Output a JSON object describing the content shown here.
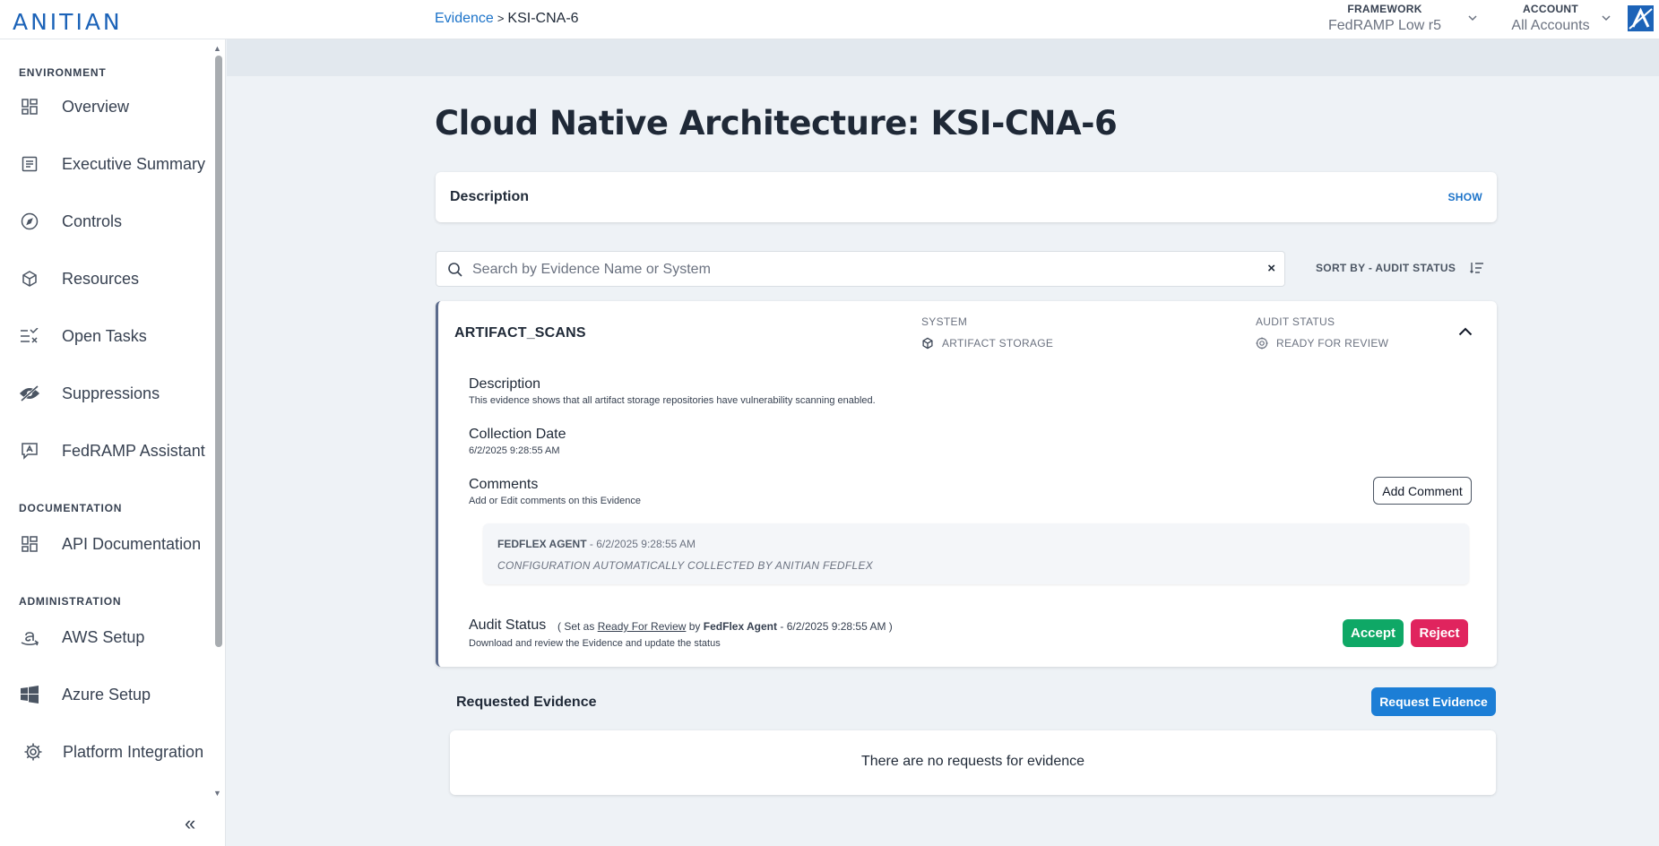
{
  "app": {
    "logo": "ANITIAN"
  },
  "header": {
    "framework_label": "FRAMEWORK",
    "framework_value": "FedRAMP Low r5",
    "account_label": "ACCOUNT",
    "account_value": "All Accounts"
  },
  "sidebar": {
    "sections": {
      "environment": "ENVIRONMENT",
      "documentation": "DOCUMENTATION",
      "administration": "ADMINISTRATION"
    },
    "items": [
      {
        "label": "Overview",
        "icon": "dashboard-icon"
      },
      {
        "label": "Executive Summary",
        "icon": "document-icon"
      },
      {
        "label": "Controls",
        "icon": "compass-icon"
      },
      {
        "label": "Resources",
        "icon": "cube-icon"
      },
      {
        "label": "Open Tasks",
        "icon": "tasks-icon"
      },
      {
        "label": "Suppressions",
        "icon": "eye-off-icon"
      },
      {
        "label": "FedRAMP Assistant",
        "icon": "assistant-icon"
      },
      {
        "label": "API Documentation",
        "icon": "dashboard-icon"
      },
      {
        "label": "AWS Setup",
        "icon": "amazon-icon"
      },
      {
        "label": "Azure Setup",
        "icon": "windows-icon"
      },
      {
        "label": "Platform Integration",
        "icon": "gear-icon"
      }
    ],
    "collapse_symbol": "«"
  },
  "breadcrumb": {
    "parent": "Evidence",
    "separator": ">",
    "current": "KSI-CNA-6"
  },
  "page": {
    "title": "Cloud Native Architecture: KSI-CNA-6"
  },
  "description_panel": {
    "title": "Description",
    "toggle": "SHOW"
  },
  "search": {
    "placeholder": "Search by Evidence Name or System",
    "value": "",
    "clear_symbol": "×"
  },
  "sort": {
    "label": "SORT BY - AUDIT STATUS"
  },
  "evidence": {
    "name": "ARTIFACT_SCANS",
    "system_label": "SYSTEM",
    "system_value": "ARTIFACT STORAGE",
    "audit_label": "AUDIT STATUS",
    "audit_value": "READY FOR REVIEW",
    "description_title": "Description",
    "description_text": "This evidence shows that all artifact storage repositories have vulnerability scanning enabled.",
    "collection_title": "Collection Date",
    "collection_value": "6/2/2025 9:28:55 AM",
    "comments_title": "Comments",
    "comments_sub": "Add or Edit comments on this Evidence",
    "add_comment_label": "Add Comment",
    "comment": {
      "author": "FEDFLEX AGENT",
      "timestamp": "- 6/2/2025 9:28:55 AM",
      "body": "CONFIGURATION AUTOMATICALLY COLLECTED BY ANITIAN FEDFLEX"
    },
    "audit_status_title": "Audit Status",
    "audit_prefix": "( Set as",
    "audit_status_link": "Ready For Review",
    "audit_by": "by",
    "audit_agent": "FedFlex Agent",
    "audit_suffix": "- 6/2/2025 9:28:55 AM )",
    "audit_sub": "Download and review the Evidence and update the status",
    "accept_label": "Accept",
    "reject_label": "Reject"
  },
  "requested": {
    "title": "Requested Evidence",
    "button_label": "Request Evidence",
    "empty_text": "There are no requests for evidence"
  },
  "colors": {
    "brand": "#1c63b8",
    "link": "#1c73c9",
    "accept": "#0fa866",
    "reject": "#e0245e",
    "request": "#1c7ed6"
  }
}
